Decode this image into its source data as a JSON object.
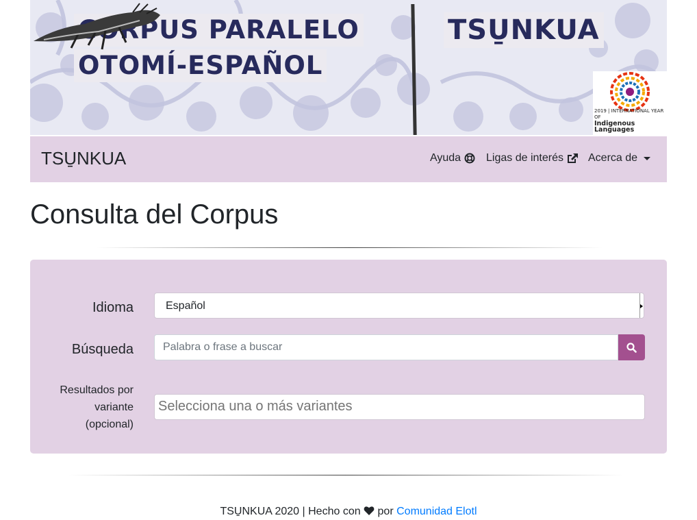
{
  "banner": {
    "title_line1": "CORPUS PARALELO",
    "title_line2": "OTOMÍ-ESPAÑOL",
    "brand": "TSU̱NKUA",
    "logo_caption_small": "2019 | INTERNATIONAL YEAR OF",
    "logo_caption_big": "Indigenous Languages"
  },
  "navbar": {
    "brand": "TSU̱NKUA",
    "items": [
      {
        "label": "Ayuda",
        "icon": "life-ring-icon"
      },
      {
        "label": "Ligas de interés",
        "icon": "external-link-icon"
      },
      {
        "label": "Acerca de",
        "icon": "caret-down-icon"
      }
    ]
  },
  "page": {
    "title": "Consulta del Corpus"
  },
  "form": {
    "idioma_label": "Idioma",
    "idioma_value": "Español",
    "busqueda_label": "Búsqueda",
    "busqueda_placeholder": "Palabra o frase a buscar",
    "busqueda_value": "",
    "resultados_label": "Resultados por variante (opcional)",
    "resultados_placeholder": "Selecciona una o más variantes"
  },
  "footer": {
    "prefix": "TSU̱NKUA 2020 | Hecho con",
    "middle": "por",
    "link_text": "Comunidad Elotl"
  },
  "colors": {
    "navbar_bg": "#e2d1e4",
    "panel_bg": "#e2d1e4",
    "button_bg": "#a3508f",
    "banner_text": "#272a5c",
    "link": "#007bff"
  }
}
